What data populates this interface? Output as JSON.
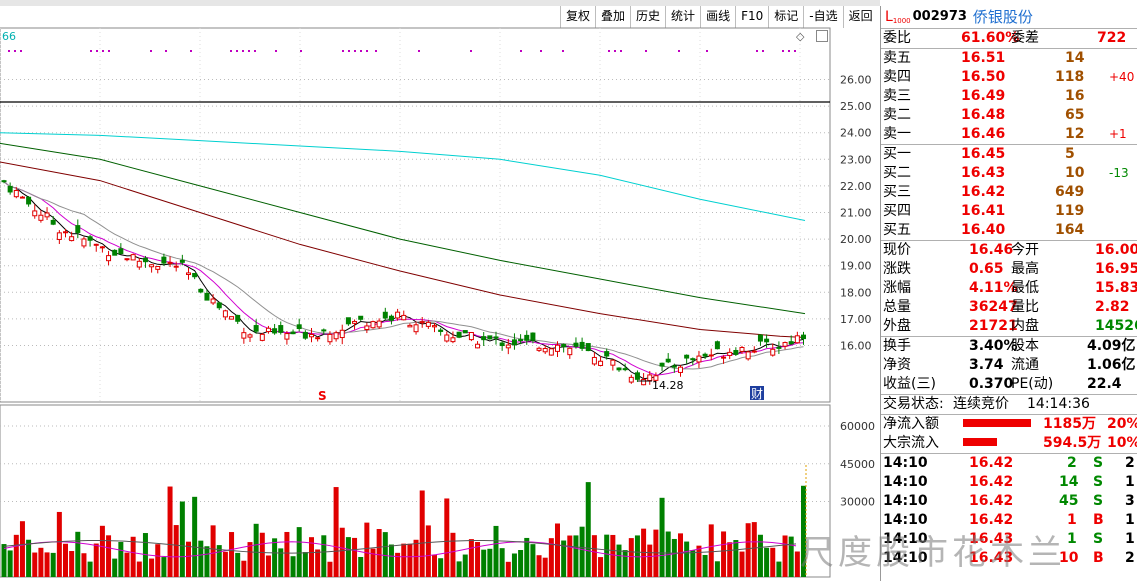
{
  "toolbar": [
    "复权",
    "叠加",
    "历史",
    "统计",
    "画线",
    "F10",
    "标记",
    "-自选",
    "返回"
  ],
  "chart": {
    "indicator_label": "66",
    "price_ticks": [
      "26.00",
      "25.00",
      "24.00",
      "23.00",
      "22.00",
      "21.00",
      "20.00",
      "19.00",
      "18.00",
      "17.00",
      "16.00"
    ],
    "volume_ticks": [
      "60000",
      "45000",
      "30000"
    ],
    "low_marker": "14.28",
    "s_marker": "S",
    "cai_marker": "财",
    "colors": {
      "up": "#e00000",
      "down": "#008000",
      "ma5": "#000000",
      "ma10": "#d000d0",
      "ma20": "#909090",
      "ma60": "#800000",
      "ma120": "#006000",
      "ma250": "#00d0d0"
    }
  },
  "quote": {
    "code_prefix": "L",
    "code_sub": "1000",
    "code": "002973",
    "name": "侨银股份",
    "weibi_label": "委比",
    "weibi_value": "61.60%",
    "weicha_label": "委差",
    "weicha_value": "722",
    "sells": [
      {
        "label": "卖五",
        "price": "16.51",
        "vol": "14",
        "chg": ""
      },
      {
        "label": "卖四",
        "price": "16.50",
        "vol": "118",
        "chg": "+40"
      },
      {
        "label": "卖三",
        "price": "16.49",
        "vol": "16",
        "chg": ""
      },
      {
        "label": "卖二",
        "price": "16.48",
        "vol": "65",
        "chg": ""
      },
      {
        "label": "卖一",
        "price": "16.46",
        "vol": "12",
        "chg": "+1"
      }
    ],
    "buys": [
      {
        "label": "买一",
        "price": "16.45",
        "vol": "5",
        "chg": ""
      },
      {
        "label": "买二",
        "price": "16.43",
        "vol": "10",
        "chg": "-13"
      },
      {
        "label": "买三",
        "price": "16.42",
        "vol": "649",
        "chg": ""
      },
      {
        "label": "买四",
        "price": "16.41",
        "vol": "119",
        "chg": ""
      },
      {
        "label": "买五",
        "price": "16.40",
        "vol": "164",
        "chg": ""
      }
    ],
    "stats": [
      {
        "l1": "现价",
        "v1": "16.46",
        "c1": "red",
        "l2": "今开",
        "v2": "16.00",
        "c2": "red"
      },
      {
        "l1": "涨跌",
        "v1": "0.65",
        "c1": "red",
        "l2": "最高",
        "v2": "16.95",
        "c2": "red"
      },
      {
        "l1": "涨幅",
        "v1": "4.11%",
        "c1": "red",
        "l2": "最低",
        "v2": "15.83",
        "c2": "red"
      },
      {
        "l1": "总量",
        "v1": "36247",
        "c1": "red",
        "l2": "量比",
        "v2": "2.82",
        "c2": "red"
      },
      {
        "l1": "外盘",
        "v1": "21721",
        "c1": "red",
        "l2": "内盘",
        "v2": "14526",
        "c2": "grn"
      }
    ],
    "stats2": [
      {
        "l1": "换手",
        "v1": "3.40%",
        "l2": "股本",
        "v2": "4.09亿"
      },
      {
        "l1": "净资",
        "v1": "3.74",
        "l2": "流通",
        "v2": "1.06亿"
      },
      {
        "l1": "收益(三)",
        "v1": "0.370",
        "l2": "PE(动)",
        "v2": "22.4"
      }
    ],
    "status_label": "交易状态:",
    "status_value": "连续竞价",
    "status_time": "14:14:36",
    "flows": [
      {
        "label": "净流入额",
        "value": "1185万",
        "pct": "20%",
        "fill": 0.2
      },
      {
        "label": "大宗流入",
        "value": "594.5万",
        "pct": "10%",
        "fill": 0.1
      }
    ],
    "ticks": [
      {
        "time": "14:10",
        "price": "16.42",
        "vol": "2",
        "side": "S",
        "num": "2"
      },
      {
        "time": "14:10",
        "price": "16.42",
        "vol": "14",
        "side": "S",
        "num": "1"
      },
      {
        "time": "14:10",
        "price": "16.42",
        "vol": "45",
        "side": "S",
        "num": "3"
      },
      {
        "time": "14:10",
        "price": "16.42",
        "vol": "1",
        "side": "B",
        "num": "1"
      },
      {
        "time": "14:10",
        "price": "16.43",
        "vol": "1",
        "side": "S",
        "num": "1"
      },
      {
        "time": "14:10",
        "price": "16.43",
        "vol": "10",
        "side": "B",
        "num": "2"
      }
    ]
  },
  "watermark": "尺度股市花木兰"
}
